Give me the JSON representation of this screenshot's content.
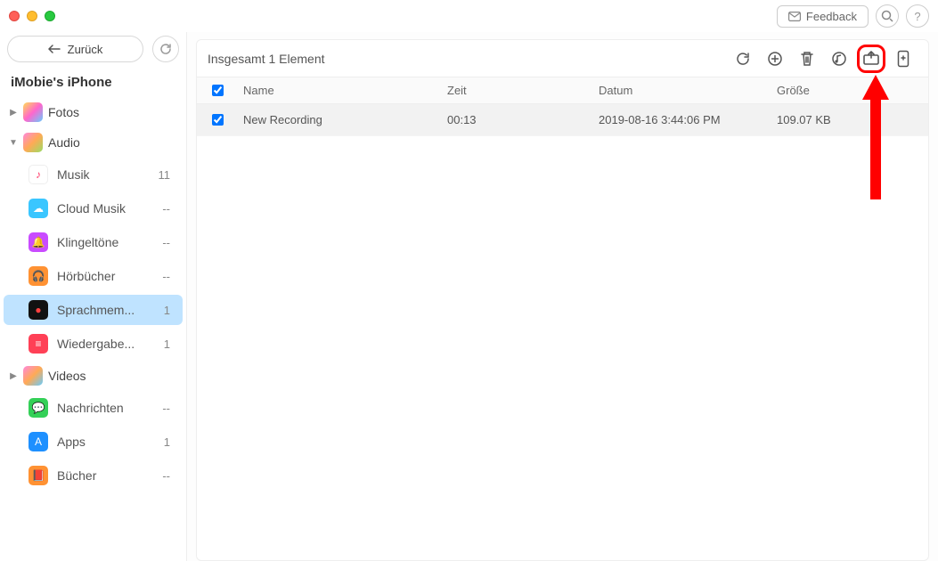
{
  "titlebar": {
    "feedback_label": "Feedback"
  },
  "sidebar": {
    "back_label": "Zurück",
    "device_title": "iMobie's iPhone",
    "cat_fotos": "Fotos",
    "cat_audio": "Audio",
    "cat_videos": "Videos",
    "items": {
      "musik": {
        "label": "Musik",
        "count": "11"
      },
      "cloudmusik": {
        "label": "Cloud Musik",
        "count": "--"
      },
      "klingeltone": {
        "label": "Klingeltöne",
        "count": "--"
      },
      "horbucher": {
        "label": "Hörbücher",
        "count": "--"
      },
      "sprachmemo": {
        "label": "Sprachmem...",
        "count": "1"
      },
      "wiedergabe": {
        "label": "Wiedergabe...",
        "count": "1"
      },
      "nachrichten": {
        "label": "Nachrichten",
        "count": "--"
      },
      "apps": {
        "label": "Apps",
        "count": "1"
      },
      "bucher": {
        "label": "Bücher",
        "count": "--"
      }
    }
  },
  "main": {
    "total_label": "Insgesamt 1 Element",
    "cols": {
      "name": "Name",
      "zeit": "Zeit",
      "datum": "Datum",
      "grosse": "Größe"
    },
    "rows": [
      {
        "name": "New Recording",
        "zeit": "00:13",
        "datum": "2019-08-16 3:44:06 PM",
        "grosse": "109.07 KB"
      }
    ]
  }
}
